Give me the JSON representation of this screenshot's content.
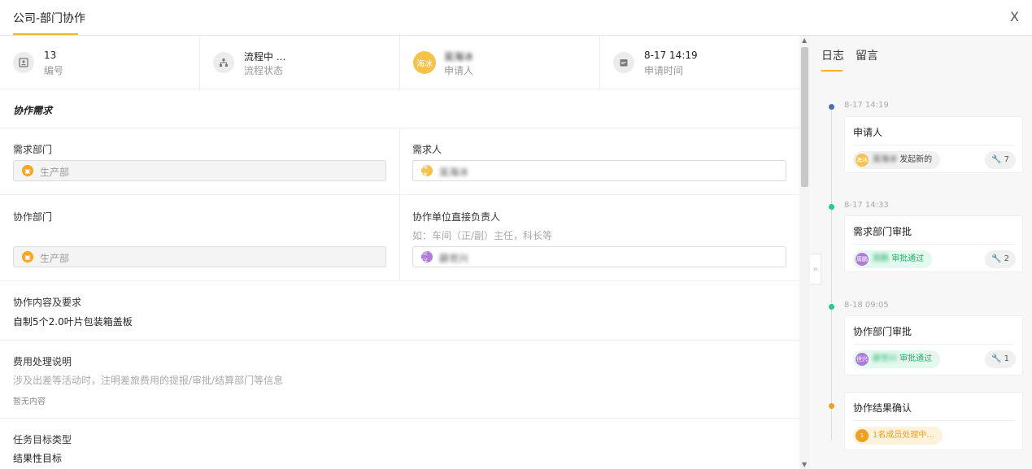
{
  "window": {
    "title": "公司-部门协作",
    "close_label": "X"
  },
  "info": [
    {
      "icon": "id-card-icon",
      "value": "13",
      "label": "编号"
    },
    {
      "icon": "flow-icon",
      "value": "流程中 ...",
      "label": "流程状态"
    },
    {
      "icon": "avatar",
      "avatar_text": "海冰",
      "value": "吴海冰",
      "label": "申请人"
    },
    {
      "icon": "calendar-icon",
      "value": "8-17 14:19",
      "label": "申请时间"
    }
  ],
  "form": {
    "section_title": "协作需求",
    "demand_dept": {
      "label": "需求部门",
      "value": "生产部"
    },
    "demander": {
      "label": "需求人",
      "avatar_text": "海冰",
      "value": "吴海冰"
    },
    "coop_dept": {
      "label": "协作部门",
      "value": "生产部"
    },
    "coop_leader": {
      "label": "协作单位直接负责人",
      "hint": "如：车间（正/副）主任，科长等",
      "avatar_text": "世兴",
      "value": "薛世兴"
    },
    "content": {
      "label": "协作内容及要求",
      "value": "自制5个2.0叶片包装箱盖板"
    },
    "cost": {
      "label": "费用处理说明",
      "hint": "涉及出差等活动时，注明差旅费用的提报/审批/结算部门等信息",
      "empty": "暂无内容"
    },
    "task_type": {
      "label": "任务目标类型",
      "value": "结果性目标"
    }
  },
  "panel": {
    "tabs": [
      "日志",
      "留言"
    ],
    "timeline": [
      {
        "time": "8-17 14:19",
        "title": "申请人",
        "avatar_text": "海冰",
        "person": "吴海冰",
        "action": "发起新的",
        "count": "7",
        "pill": "gray",
        "dot_color": "#4a6fb5"
      },
      {
        "time": "8-17 14:33",
        "title": "需求部门审批",
        "avatar_text": "周鹏",
        "person": "周鹏",
        "action": "审批通过",
        "count": "2",
        "pill": "green",
        "dot_color": "#20c997"
      },
      {
        "time": "8-18 09:05",
        "title": "协作部门审批",
        "avatar_text": "世兴",
        "person": "薛世兴",
        "action": "审批通过",
        "count": "1",
        "pill": "green",
        "dot_color": "#20c997"
      },
      {
        "time": "",
        "title": "协作结果确认",
        "avatar_text": "1",
        "person": "",
        "action": "1名成员处理中...",
        "count": "",
        "pill": "orange",
        "dot_color": "#f0a020"
      }
    ]
  },
  "colors": {
    "accent": "#f0b429",
    "success": "#20b26b",
    "warning": "#f0a020"
  }
}
